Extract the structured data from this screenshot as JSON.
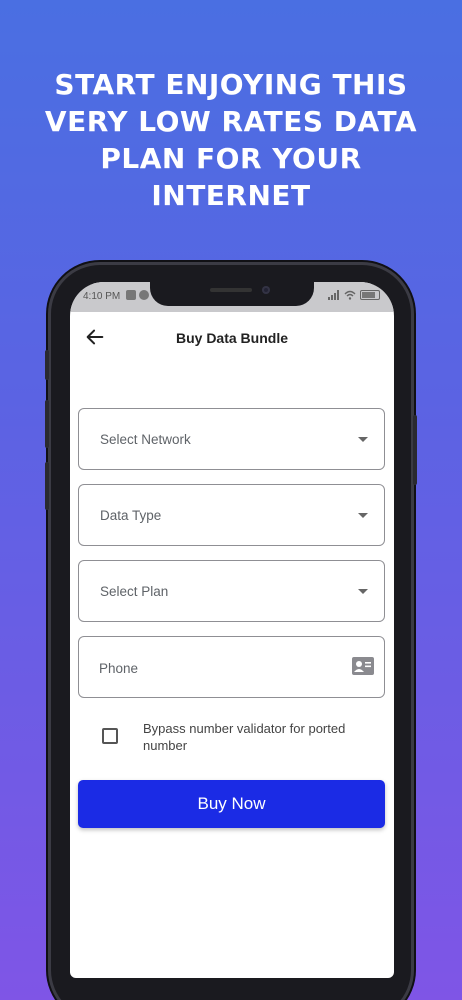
{
  "headline": {
    "line1": "START ENJOYING THIS",
    "line2": "VERY LOW RATES DATA",
    "line3": "PLAN FOR YOUR",
    "line4": "INTERNET"
  },
  "status_bar": {
    "time": "4:10 PM"
  },
  "app_bar": {
    "title": "Buy Data Bundle",
    "back_icon": "arrow-left-icon"
  },
  "form": {
    "network_label": "Select Network",
    "data_type_label": "Data Type",
    "plan_label": "Select Plan",
    "phone_placeholder": "Phone",
    "phone_value": "",
    "contact_icon": "contact-card-icon",
    "bypass_label": "Bypass number validator for ported number",
    "bypass_checked": false,
    "buy_button_label": "Buy Now"
  },
  "colors": {
    "background_top": "#4a6fe2",
    "background_bottom": "#7f55e6",
    "button": "#1b2be5"
  }
}
